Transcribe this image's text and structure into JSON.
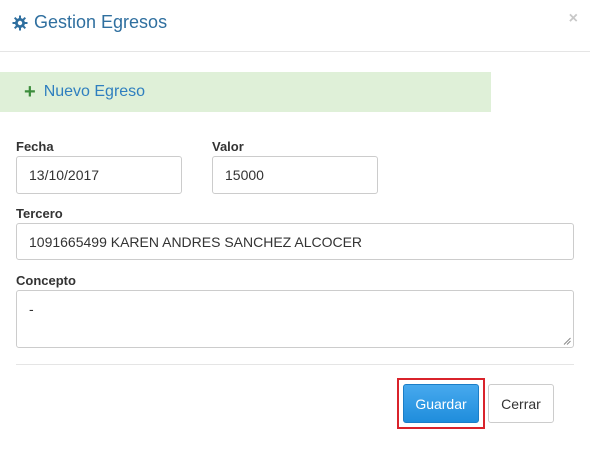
{
  "header": {
    "title": "Gestion Egresos",
    "title_icon": "gear-icon",
    "close_label": "×"
  },
  "section": {
    "icon": "plus-icon",
    "plus": "+",
    "title": "Nuevo Egreso"
  },
  "form": {
    "fecha": {
      "label": "Fecha",
      "value": "13/10/2017"
    },
    "valor": {
      "label": "Valor",
      "value": "15000"
    },
    "tercero": {
      "label": "Tercero",
      "value": "1091665499  KAREN ANDRES SANCHEZ ALCOCER"
    },
    "concepto": {
      "label": "Concepto",
      "value": "-"
    }
  },
  "footer": {
    "save_label": "Guardar",
    "close_label": "Cerrar"
  },
  "colors": {
    "title": "#2f6f9f",
    "section_bg": "#dff0d8",
    "primary_button": "#2a97e4",
    "highlight": "#d9232b"
  }
}
